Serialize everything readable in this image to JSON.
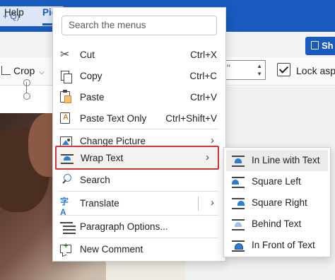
{
  "background": {
    "search_stub": "+ Q)",
    "tabs": {
      "help": "Help",
      "picture": "Pic"
    },
    "share_label": "Sh",
    "crop_label": "Crop",
    "size_spinner_text": "\"",
    "lock_label": "Lock aspe"
  },
  "context_menu": {
    "search_placeholder": "Search the menus",
    "items": [
      {
        "label": "Cut",
        "shortcut": "Ctrl+X",
        "icon": "scissors-icon"
      },
      {
        "label": "Copy",
        "shortcut": "Ctrl+C",
        "icon": "copy-icon"
      },
      {
        "label": "Paste",
        "shortcut": "Ctrl+V",
        "icon": "paste-icon"
      },
      {
        "label": "Paste Text Only",
        "shortcut": "Ctrl+Shift+V",
        "icon": "paste-text-only-icon"
      },
      {
        "label": "Change Picture",
        "shortcut": "",
        "icon": "change-picture-icon",
        "has_submenu": true
      },
      {
        "label": "Wrap Text",
        "shortcut": "",
        "icon": "wrap-text-icon",
        "has_submenu": true,
        "active": true
      },
      {
        "label": "Search",
        "shortcut": "",
        "icon": "search-icon"
      },
      {
        "label": "Translate",
        "shortcut": "",
        "icon": "translate-icon",
        "has_submenu": true
      },
      {
        "label": "Paragraph Options...",
        "shortcut": "",
        "icon": "paragraph-icon"
      },
      {
        "label": "New Comment",
        "shortcut": "",
        "icon": "new-comment-icon"
      }
    ],
    "chevron": "›"
  },
  "wrap_submenu": {
    "items": [
      {
        "label": "In Line with Text",
        "icon": "in-line-with-text-icon",
        "hover": true
      },
      {
        "label": "Square Left",
        "icon": "square-left-icon"
      },
      {
        "label": "Square Right",
        "icon": "square-right-icon"
      },
      {
        "label": "Behind Text",
        "icon": "behind-text-icon"
      },
      {
        "label": "In Front of Text",
        "icon": "in-front-of-text-icon"
      }
    ]
  },
  "colors": {
    "accent": "#185abd",
    "highlight_border": "#d13438",
    "icon_blue": "#2b7cd3"
  }
}
